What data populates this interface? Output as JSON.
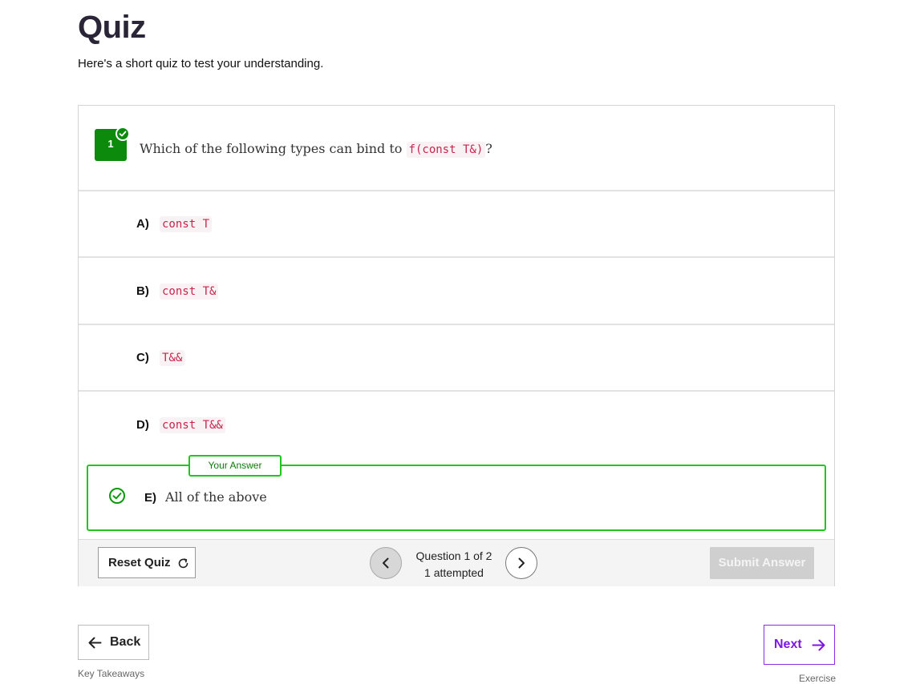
{
  "page": {
    "title": "Quiz",
    "subtitle": "Here's a short quiz to test your understanding."
  },
  "question": {
    "number": "1",
    "text_before": "Which of the following types can bind to",
    "code": "f(const T&)",
    "text_after": "?"
  },
  "options": [
    {
      "letter": "A)",
      "code": "const T"
    },
    {
      "letter": "B)",
      "code": "const T&"
    },
    {
      "letter": "C)",
      "code": "T&&"
    },
    {
      "letter": "D)",
      "code": "const T&&"
    }
  ],
  "selected_option": {
    "tag": "Your Answer",
    "letter": "E)",
    "text": "All of the above"
  },
  "footer": {
    "reset_label": "Reset Quiz",
    "question_status": "Question 1 of 2",
    "attempted_status": "1 attempted",
    "submit_label": "Submit Answer"
  },
  "navigation": {
    "back_label": "Back",
    "back_target": "Key Takeaways",
    "next_label": "Next",
    "next_target": "Exercise"
  },
  "colors": {
    "correct_green": "#0c8a0c",
    "answer_border": "#1ec71e",
    "accent_purple": "#7c17e0",
    "code_text": "#c7254e"
  },
  "icons": {
    "badge_check": "check-circle-icon",
    "answer_check": "check-circle-icon",
    "reset": "refresh-icon",
    "prev": "chevron-left-icon",
    "next": "chevron-right-icon",
    "back": "arrow-left-icon",
    "forward": "arrow-right-icon"
  }
}
